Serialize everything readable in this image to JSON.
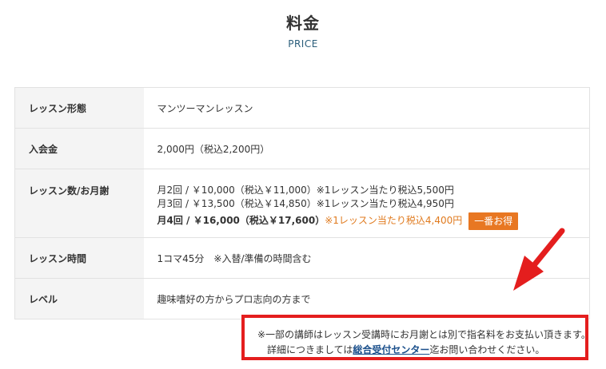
{
  "header": {
    "title": "料金",
    "subtitle": "PRICE"
  },
  "table": {
    "rows": [
      {
        "label": "レッスン形態",
        "value": "マンツーマンレッスン"
      },
      {
        "label": "入会金",
        "value": "2,000円（税込2,200円）"
      },
      {
        "label": "レッスン数/お月謝",
        "lines": [
          {
            "main": "月2回 / ￥10,000（税込￥11,000）",
            "note": "※1レッスン当たり税込5,500円"
          },
          {
            "main": "月3回 / ￥13,500（税込￥14,850）",
            "note": "※1レッスン当たり税込4,950円"
          },
          {
            "main": "月4回 / ￥16,000（税込￥17,600）",
            "note": "※1レッスン当たり税込4,400円",
            "badge": "一番お得"
          }
        ]
      },
      {
        "label": "レッスン時間",
        "value": "1コマ45分　※入替/準備の時間含む"
      },
      {
        "label": "レベル",
        "value": "趣味嗜好の方からプロ志向の方まで"
      }
    ]
  },
  "notice": {
    "line1": "※一部の講師はレッスン受講時にお月謝とは別で指名料をお支払い頂きます。",
    "line2_prefix": "詳細につきましては",
    "link": "総合受付センター",
    "line2_suffix": "迄お問い合わせください。"
  },
  "colors": {
    "accent": "#e87722",
    "highlight_border": "#e41e1e",
    "link": "#1a4f8b",
    "arrow": "#e41e1e"
  }
}
